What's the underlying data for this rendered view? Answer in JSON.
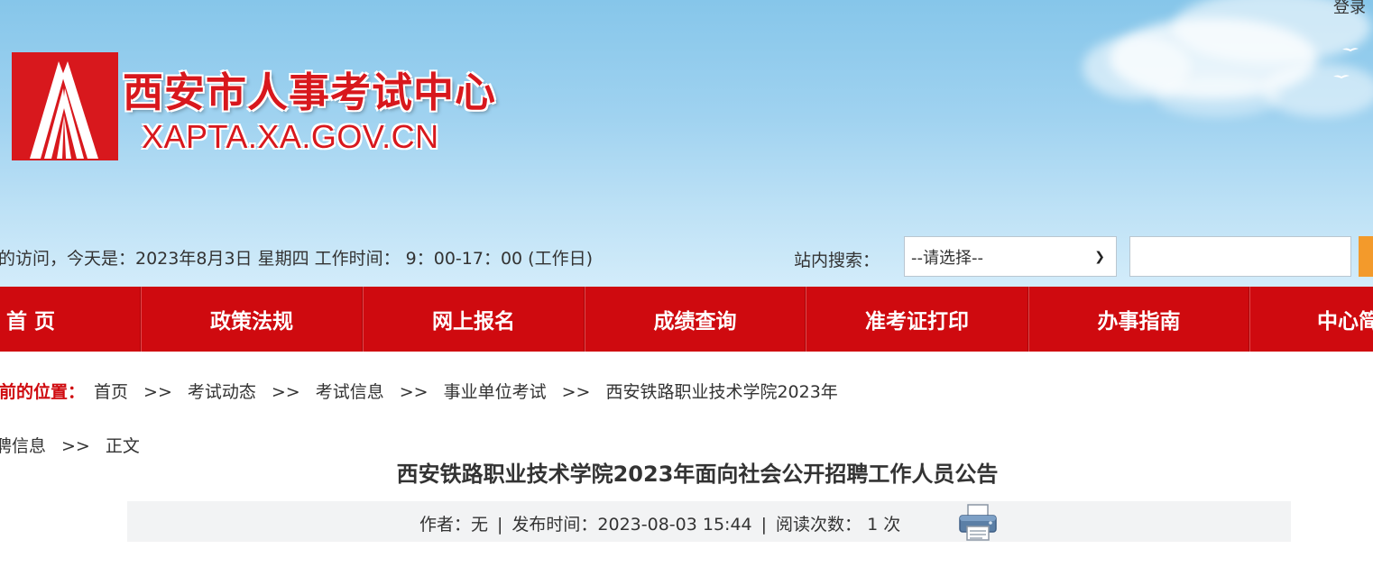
{
  "header": {
    "login_label": "登录",
    "site_name": "西安市人事考试中心",
    "site_domain": "XAPTA.XA.GOV.CN",
    "welcome_text": "的访问，今天是：2023年8月3日 星期四  工作时间： 9：00-17：00 (工作日)",
    "search": {
      "label": "站内搜索：",
      "select_value": "--请选择--",
      "input_value": ""
    }
  },
  "colors": {
    "brand_red": "#cf0a0f",
    "logo_red": "#d8181d",
    "search_button": "#f39a2b"
  },
  "nav": {
    "items": [
      {
        "label": "首  页"
      },
      {
        "label": "政策法规"
      },
      {
        "label": "网上报名"
      },
      {
        "label": "成绩查询"
      },
      {
        "label": "准考证打印"
      },
      {
        "label": "办事指南"
      },
      {
        "label": "中心简"
      }
    ]
  },
  "breadcrumb": {
    "label": "当前的位置：",
    "items": [
      "首页",
      "考试动态",
      "考试信息",
      "事业单位考试",
      "西安铁路职业技术学院2023年",
      "聘信息",
      "正文"
    ],
    "separator": ">>"
  },
  "article": {
    "title": "西安铁路职业技术学院2023年面向社会公开招聘工作人员公告",
    "author": "作者：无",
    "publish_time": "发布时间：2023-08-03 15:44",
    "read_count": "阅读次数： 1 次",
    "print_icon": "printer-icon"
  }
}
